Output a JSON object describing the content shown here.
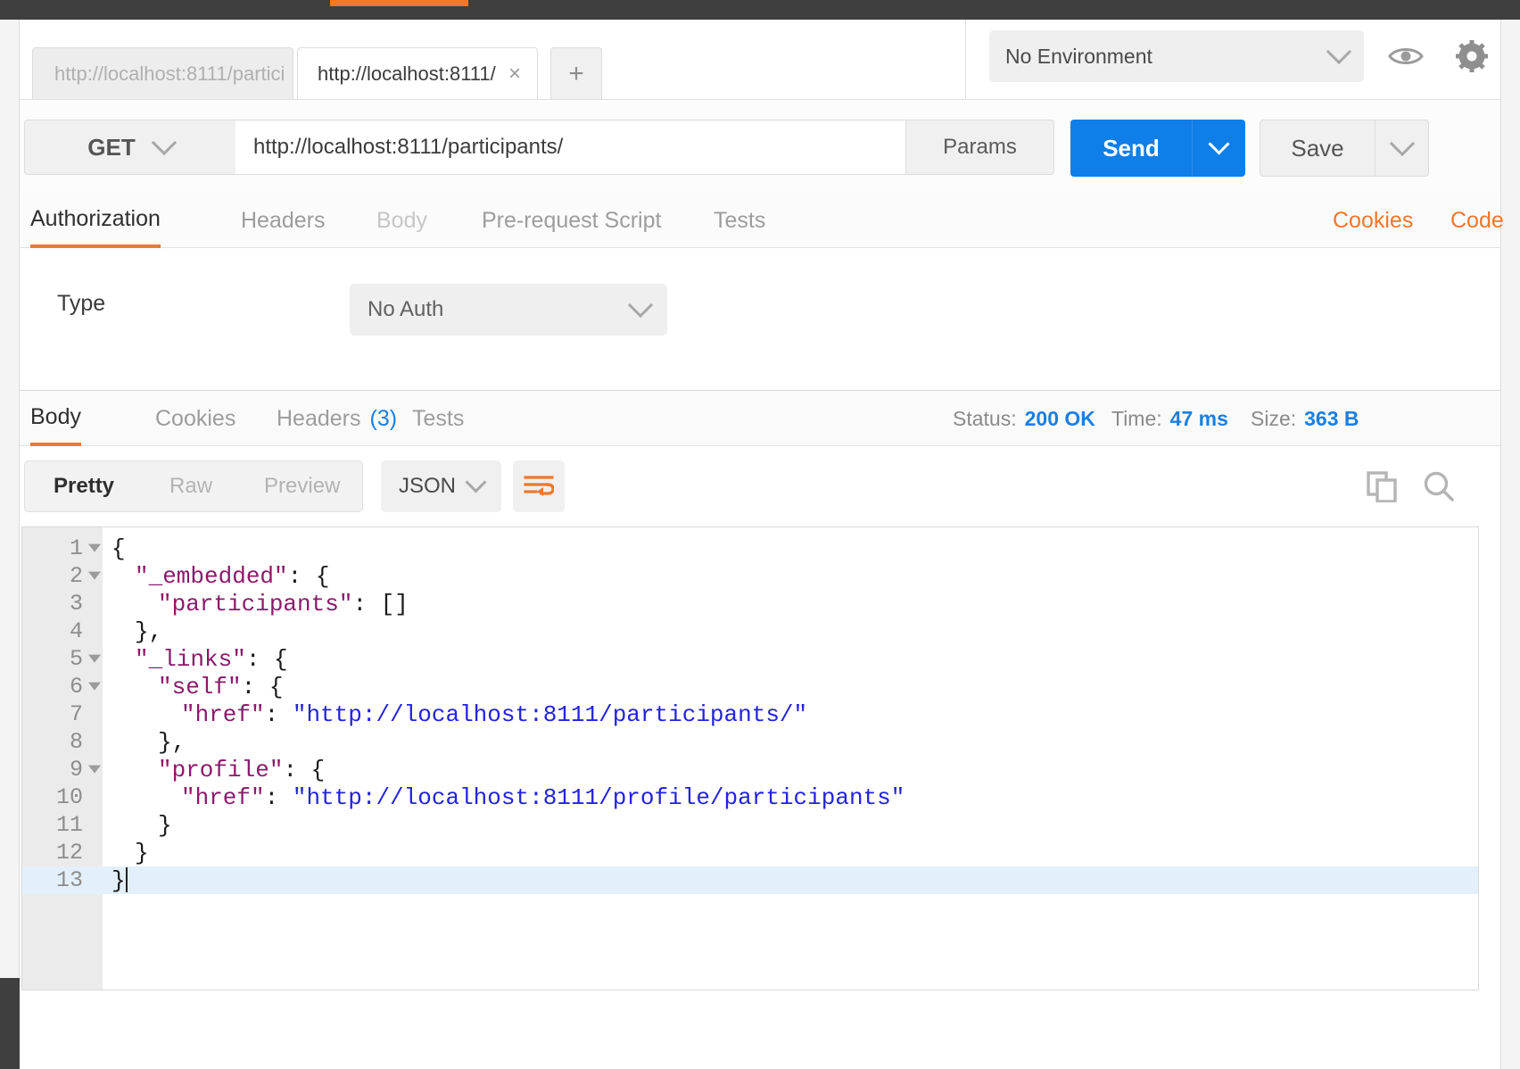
{
  "window": {
    "accent_color": "#f2772b",
    "primary_button_color": "#0f7ee9",
    "link_color": "#1b7fe0"
  },
  "tabs": {
    "inactive_tab_label": "http://localhost:8111/partici",
    "active_tab_label": "http://localhost:8111/",
    "close_icon": "×",
    "add_tab_label": "+"
  },
  "environment": {
    "selected": "No Environment",
    "eye_icon": "eye-icon",
    "gear_icon": "gear-icon"
  },
  "request": {
    "method": "GET",
    "url": "http://localhost:8111/participants/",
    "params_label": "Params",
    "send_label": "Send",
    "save_label": "Save"
  },
  "request_tabs": [
    {
      "label": "Authorization",
      "state": "selected"
    },
    {
      "label": "Headers",
      "state": "normal"
    },
    {
      "label": "Body",
      "state": "dim"
    },
    {
      "label": "Pre-request Script",
      "state": "normal"
    },
    {
      "label": "Tests",
      "state": "normal"
    }
  ],
  "request_links": [
    {
      "label": "Cookies"
    },
    {
      "label": "Code"
    }
  ],
  "authorization": {
    "type_label": "Type",
    "type_value": "No Auth"
  },
  "response_tabs": [
    {
      "label": "Body",
      "state": "selected",
      "badge": ""
    },
    {
      "label": "Cookies",
      "state": "normal",
      "badge": ""
    },
    {
      "label": "Headers",
      "state": "normal",
      "badge": "(3)"
    },
    {
      "label": "Tests",
      "state": "normal",
      "badge": ""
    }
  ],
  "response_meta": {
    "status_label": "Status:",
    "status_value": "200 OK",
    "time_label": "Time:",
    "time_value": "47 ms",
    "size_label": "Size:",
    "size_value": "363 B"
  },
  "body_toolbar": {
    "view_modes": [
      {
        "label": "Pretty",
        "state": "selected"
      },
      {
        "label": "Raw",
        "state": "normal"
      },
      {
        "label": "Preview",
        "state": "normal"
      }
    ],
    "format": "JSON",
    "wrap_icon": "wrap-lines-icon",
    "copy_icon": "copy-icon",
    "search_icon": "search-icon"
  },
  "response_body": {
    "language": "json",
    "highlighted_line": 13,
    "lines": [
      {
        "n": "1",
        "fold": true,
        "indent": 0,
        "tokens": [
          {
            "t": "{",
            "c": "p"
          }
        ]
      },
      {
        "n": "2",
        "fold": true,
        "indent": 1,
        "tokens": [
          {
            "t": "\"_embedded\"",
            "c": "k"
          },
          {
            "t": ": {",
            "c": "p"
          }
        ]
      },
      {
        "n": "3",
        "fold": false,
        "indent": 2,
        "tokens": [
          {
            "t": "\"participants\"",
            "c": "k"
          },
          {
            "t": ": []",
            "c": "p"
          }
        ]
      },
      {
        "n": "4",
        "fold": false,
        "indent": 1,
        "tokens": [
          {
            "t": "},",
            "c": "p"
          }
        ]
      },
      {
        "n": "5",
        "fold": true,
        "indent": 1,
        "tokens": [
          {
            "t": "\"_links\"",
            "c": "k"
          },
          {
            "t": ": {",
            "c": "p"
          }
        ]
      },
      {
        "n": "6",
        "fold": true,
        "indent": 2,
        "tokens": [
          {
            "t": "\"self\"",
            "c": "k"
          },
          {
            "t": ": {",
            "c": "p"
          }
        ]
      },
      {
        "n": "7",
        "fold": false,
        "indent": 3,
        "tokens": [
          {
            "t": "\"href\"",
            "c": "k"
          },
          {
            "t": ": ",
            "c": "p"
          },
          {
            "t": "\"http://localhost:8111/participants/\"",
            "c": "s"
          }
        ]
      },
      {
        "n": "8",
        "fold": false,
        "indent": 2,
        "tokens": [
          {
            "t": "},",
            "c": "p"
          }
        ]
      },
      {
        "n": "9",
        "fold": true,
        "indent": 2,
        "tokens": [
          {
            "t": "\"profile\"",
            "c": "k"
          },
          {
            "t": ": {",
            "c": "p"
          }
        ]
      },
      {
        "n": "10",
        "fold": false,
        "indent": 3,
        "tokens": [
          {
            "t": "\"href\"",
            "c": "k"
          },
          {
            "t": ": ",
            "c": "p"
          },
          {
            "t": "\"http://localhost:8111/profile/participants\"",
            "c": "s"
          }
        ]
      },
      {
        "n": "11",
        "fold": false,
        "indent": 2,
        "tokens": [
          {
            "t": "}",
            "c": "p"
          }
        ]
      },
      {
        "n": "12",
        "fold": false,
        "indent": 1,
        "tokens": [
          {
            "t": "}",
            "c": "p"
          }
        ]
      },
      {
        "n": "13",
        "fold": false,
        "indent": 0,
        "tokens": [
          {
            "t": "}",
            "c": "p"
          }
        ]
      }
    ]
  }
}
